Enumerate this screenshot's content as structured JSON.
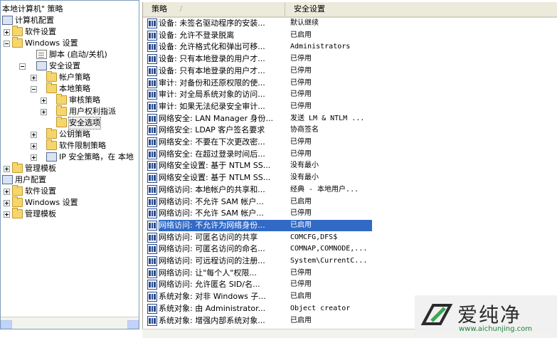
{
  "tree": {
    "nodes": [
      {
        "label": "本地计算机\" 策略",
        "icon": "computer-policy-icon",
        "pm": ""
      },
      {
        "label": "计算机配置",
        "icon": "computer-icon",
        "pm": ""
      },
      {
        "label": "软件设置",
        "icon": "folder-icon",
        "pm": "plus"
      },
      {
        "label": "Windows 设置",
        "icon": "folder-icon",
        "pm": "minus"
      },
      {
        "label": "脚本 (启动/关机)",
        "icon": "script-icon",
        "pm": ""
      },
      {
        "label": "安全设置",
        "icon": "security-icon",
        "pm": "minus"
      },
      {
        "label": "帐户策略",
        "icon": "folder-icon",
        "pm": "plus"
      },
      {
        "label": "本地策略",
        "icon": "folder-icon",
        "pm": "minus"
      },
      {
        "label": "审核策略",
        "icon": "folder-icon",
        "pm": "plus"
      },
      {
        "label": "用户权利指派",
        "icon": "folder-icon",
        "pm": "plus"
      },
      {
        "label": "安全选项",
        "icon": "folder-icon",
        "pm": ""
      },
      {
        "label": "公钥策略",
        "icon": "folder-icon",
        "pm": "plus"
      },
      {
        "label": "软件限制策略",
        "icon": "folder-icon",
        "pm": "plus"
      },
      {
        "label": "IP 安全策略，在 本地",
        "icon": "ip-security-icon",
        "pm": "plus"
      },
      {
        "label": "管理模板",
        "icon": "folder-icon",
        "pm": "plus"
      },
      {
        "label": "用户配置",
        "icon": "user-icon",
        "pm": ""
      },
      {
        "label": "软件设置",
        "icon": "folder-icon",
        "pm": "plus"
      },
      {
        "label": "Windows 设置",
        "icon": "folder-icon",
        "pm": "plus"
      },
      {
        "label": "管理模板",
        "icon": "folder-icon",
        "pm": "plus"
      }
    ]
  },
  "list": {
    "columns": [
      "策略",
      "安全设置"
    ],
    "sort_indicator": "/",
    "rows": [
      [
        "设备: 未签名驱动程序的安装...",
        "默认继续"
      ],
      [
        "设备: 允许不登录脱离",
        "已启用"
      ],
      [
        "设备: 允许格式化和弹出可移...",
        "Administrators"
      ],
      [
        "设备: 只有本地登录的用户才...",
        "已停用"
      ],
      [
        "设备: 只有本地登录的用户才...",
        "已停用"
      ],
      [
        "审计: 对备份和还原权限的使...",
        "已停用"
      ],
      [
        "审计: 对全局系统对象的访问...",
        "已停用"
      ],
      [
        "审计: 如果无法纪录安全审计...",
        "已停用"
      ],
      [
        "网络安全: LAN Manager 身份...",
        "发送 LM & NTLM ..."
      ],
      [
        "网络安全: LDAP 客户签名要求",
        "协商签名"
      ],
      [
        "网络安全: 不要在下次更改密...",
        "已停用"
      ],
      [
        "网络安全: 在超过登录时间后...",
        "已停用"
      ],
      [
        "网络安全设置: 基于 NTLM SS...",
        "没有最小"
      ],
      [
        "网络安全设置: 基于 NTLM SS...",
        "没有最小"
      ],
      [
        "网络访问: 本地帐户的共享和...",
        "经典 - 本地用户..."
      ],
      [
        "网络访问: 不允许 SAM 帐户...",
        "已启用"
      ],
      [
        "网络访问: 不允许 SAM 帐户...",
        "已停用"
      ],
      [
        "网络访问: 不允许为网络身份...",
        "已启用"
      ],
      [
        "网络访问: 可匿名访问的共享",
        "COMCFG,DFS$"
      ],
      [
        "网络访问: 可匿名访问的命名...",
        "COMNAP,COMNODE,..."
      ],
      [
        "网络访问: 可远程访问的注册...",
        "System\\CurrentC..."
      ],
      [
        "网络访问: 让\"每个人\"权限...",
        "已停用"
      ],
      [
        "网络访问: 允许匿名 SID/名...",
        "已停用"
      ],
      [
        "系统对象: 对非 Windows 子...",
        "已启用"
      ],
      [
        "系统对象: 由 Administrator...",
        "Object creator"
      ],
      [
        "系统对象: 增强内部系统对象...",
        "已启用"
      ]
    ],
    "selected_row": 17
  },
  "watermark": {
    "brand": "爱纯净",
    "url": "www.aichunjing.com"
  }
}
